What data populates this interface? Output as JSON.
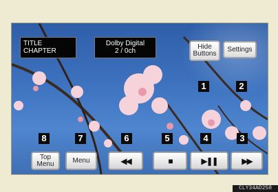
{
  "screen": {
    "title_lines": [
      "TITLE",
      "CHAPTER"
    ],
    "audio_lines": [
      "Dolby Digital",
      "2 / 0ch"
    ]
  },
  "buttons": {
    "hide_lines": [
      "Hide",
      "Buttons"
    ],
    "settings": "Settings",
    "top_menu_lines": [
      "Top",
      "Menu"
    ],
    "menu": "Menu"
  },
  "callouts": [
    "1",
    "2",
    "3",
    "4",
    "5",
    "6",
    "7",
    "8"
  ],
  "icons": {
    "rewind": "rewind-icon",
    "stop": "stop-icon",
    "play_pause": "play-pause-icon",
    "fast_forward": "fast-forward-icon"
  },
  "figure_code": "CLY34AD258",
  "colors": {
    "background": "#efebd2",
    "sky": "#3d72bf",
    "blossom": "#f4c9d2"
  }
}
